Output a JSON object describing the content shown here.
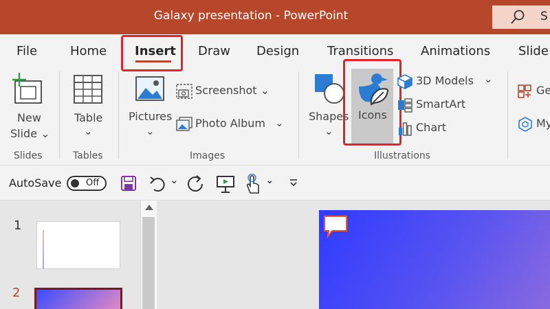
{
  "titlebar": {
    "title": "Galaxy presentation  -  PowerPoint",
    "search_text": "S"
  },
  "tabs": [
    "File",
    "Home",
    "Insert",
    "Draw",
    "Design",
    "Transitions",
    "Animations",
    "Slide"
  ],
  "active_tab": "Insert",
  "ribbon": {
    "new_slide": [
      "New",
      "Slide ⌄"
    ],
    "table": [
      "Table",
      "⌄"
    ],
    "pictures": [
      "Pictures",
      "⌄"
    ],
    "screenshot": "Screenshot ⌄",
    "photo_album": "Photo Album",
    "shapes": [
      "Shapes",
      "⌄"
    ],
    "icons": "Icons",
    "models_3d": "3D Models",
    "smartart": "SmartArt",
    "chart": "Chart",
    "get_addins": "Ge",
    "my_addins": "My",
    "groups": [
      "Slides",
      "Tables",
      "Images",
      "Illustrations"
    ]
  },
  "qat": {
    "autosave_label": "AutoSave",
    "toggle_state": "Off"
  },
  "slides": {
    "numbers": [
      "1",
      "2"
    ]
  },
  "colors": {
    "accent": "#b7472a",
    "highlight": "#e0232b"
  }
}
